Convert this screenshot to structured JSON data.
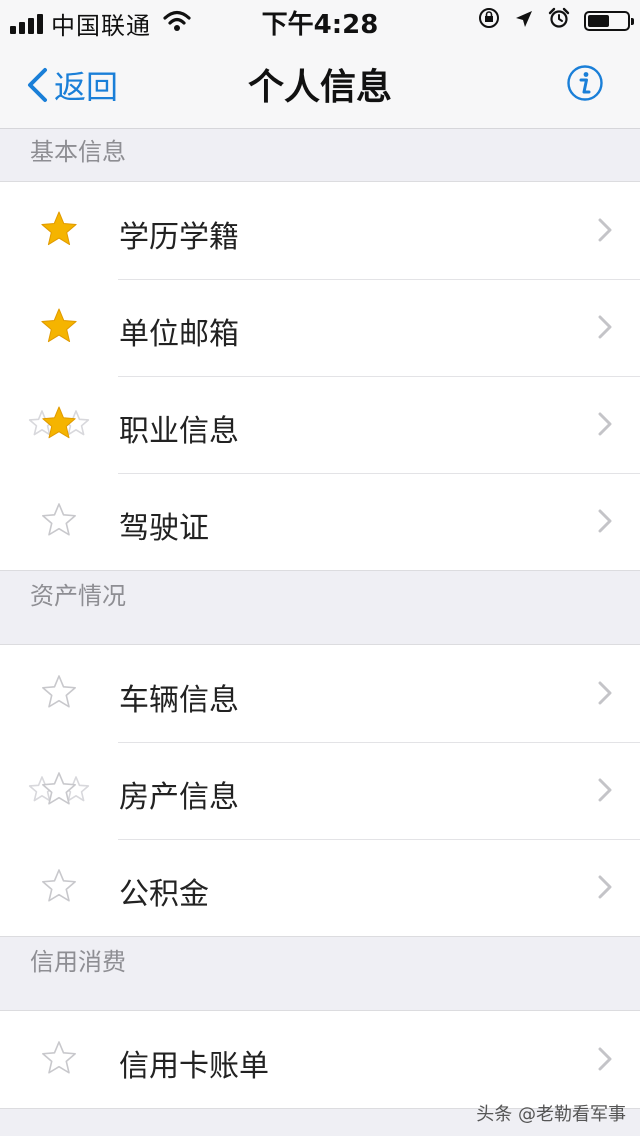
{
  "status_bar": {
    "carrier": "中国联通",
    "time": "下午4:28",
    "battery_level": 0.58
  },
  "nav": {
    "back_label": "返回",
    "title": "个人信息",
    "info_icon": "info-circle-icon"
  },
  "colors": {
    "accent": "#1a7fd8",
    "star_filled": "#f5b400",
    "star_outline": "#c8c8cc",
    "background": "#efeff4"
  },
  "sections": [
    {
      "header": "基本信息",
      "items": [
        {
          "label": "学历学籍",
          "star": "filled"
        },
        {
          "label": "单位邮箱",
          "star": "filled"
        },
        {
          "label": "职业信息",
          "star": "triple-filled"
        },
        {
          "label": "驾驶证",
          "star": "outline"
        }
      ]
    },
    {
      "header": "资产情况",
      "items": [
        {
          "label": "车辆信息",
          "star": "outline"
        },
        {
          "label": "房产信息",
          "star": "triple-outline"
        },
        {
          "label": "公积金",
          "star": "outline"
        }
      ]
    },
    {
      "header": "信用消费",
      "items": [
        {
          "label": "信用卡账单",
          "star": "outline"
        }
      ]
    }
  ],
  "watermark": "头条 @老勒看军事"
}
